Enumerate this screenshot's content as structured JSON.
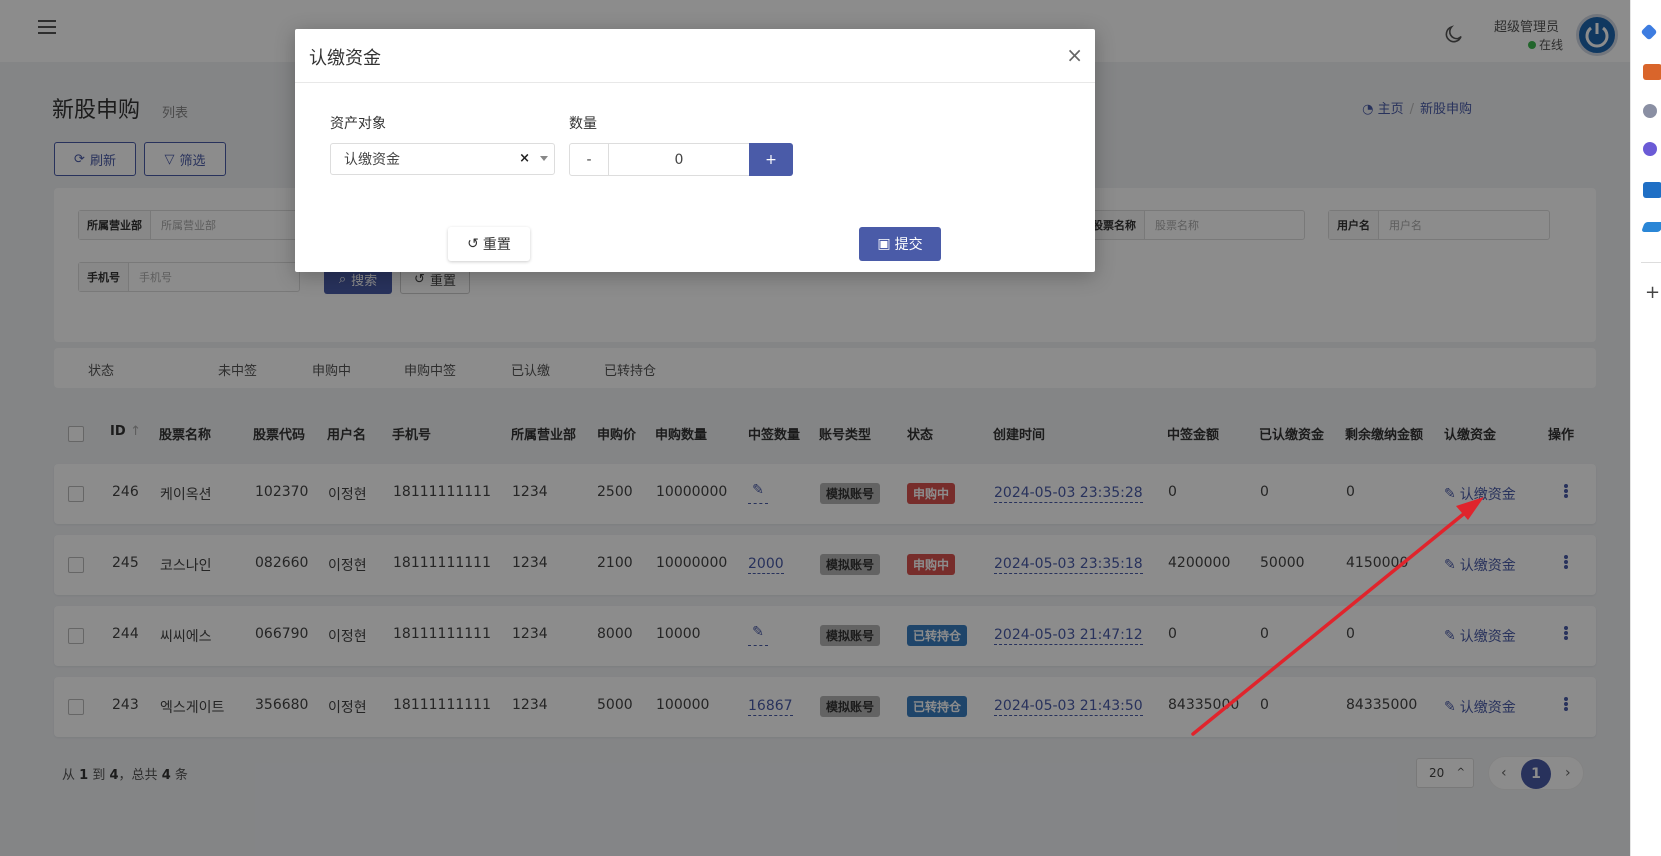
{
  "header": {
    "user_name": "超级管理员",
    "user_status": "在线"
  },
  "page": {
    "title": "新股申购",
    "subtitle": "列表",
    "breadcrumb": [
      "主页",
      "新股申购"
    ]
  },
  "toolbar": {
    "refresh_label": "刷新",
    "filter_label": "筛选"
  },
  "filters": {
    "fields": [
      {
        "label": "所属营业部",
        "placeholder": "所属营业部"
      },
      {
        "label": "股票名称",
        "placeholder": "股票名称"
      },
      {
        "label": "用户名",
        "placeholder": "用户名"
      },
      {
        "label": "手机号",
        "placeholder": "手机号"
      }
    ],
    "search_label": "搜索",
    "reset_label": "重置"
  },
  "status_tabs": [
    "状态",
    "未中签",
    "申购中",
    "申购中签",
    "已认缴",
    "已转持仓"
  ],
  "table": {
    "columns": [
      "ID",
      "股票名称",
      "股票代码",
      "用户名",
      "手机号",
      "所属营业部",
      "申购价",
      "申购数量",
      "中签数量",
      "账号类型",
      "状态",
      "创建时间",
      "中签金额",
      "已认缴资金",
      "剩余缴纳金额",
      "认缴资金",
      "操作"
    ],
    "sort_indicator": "↑",
    "rows": [
      {
        "id": "246",
        "name": "케이옥션",
        "code": "102370",
        "user": "이정현",
        "phone": "18111111111",
        "branch": "1234",
        "price": "2500",
        "qty": "10000000",
        "won": "",
        "acct": "模拟账号",
        "status": "申购中",
        "status_color": "#d9534f",
        "created": "2024-05-03 23:35:28",
        "won_amount": "0",
        "paid": "0",
        "remaining": "0",
        "action": "认缴资金"
      },
      {
        "id": "245",
        "name": "코스나인",
        "code": "082660",
        "user": "이정현",
        "phone": "18111111111",
        "branch": "1234",
        "price": "2100",
        "qty": "10000000",
        "won": "2000",
        "acct": "模拟账号",
        "status": "申购中",
        "status_color": "#d9534f",
        "created": "2024-05-03 23:35:18",
        "won_amount": "4200000",
        "paid": "50000",
        "remaining": "4150000",
        "action": "认缴资金"
      },
      {
        "id": "244",
        "name": "씨씨에스",
        "code": "066790",
        "user": "이정현",
        "phone": "18111111111",
        "branch": "1234",
        "price": "8000",
        "qty": "10000",
        "won": "",
        "acct": "模拟账号",
        "status": "已转持仓",
        "status_color": "#3a7fc2",
        "created": "2024-05-03 21:47:12",
        "won_amount": "0",
        "paid": "0",
        "remaining": "0",
        "action": "认缴资金"
      },
      {
        "id": "243",
        "name": "엑스게이트",
        "code": "356680",
        "user": "이정현",
        "phone": "18111111111",
        "branch": "1234",
        "price": "5000",
        "qty": "100000",
        "won": "16867",
        "acct": "模拟账号",
        "status": "已转持仓",
        "status_color": "#3a7fc2",
        "created": "2024-05-03 21:43:50",
        "won_amount": "84335000",
        "paid": "0",
        "remaining": "84335000",
        "action": "认缴资金"
      }
    ]
  },
  "pagination": {
    "info_prefix": "从",
    "from": "1",
    "to_word": "到",
    "to": "4",
    "total_word": "，总共",
    "total": "4",
    "unit": "条",
    "page_size": "20",
    "current_page": "1"
  },
  "modal": {
    "title": "认缴资金",
    "close": "×",
    "asset_label": "资产对象",
    "asset_value": "认缴资金",
    "clear": "×",
    "qty_label": "数量",
    "qty_value": "0",
    "minus": "-",
    "plus": "+",
    "reset_label": "重置",
    "submit_label": "提交"
  },
  "colors": {
    "primary": "#4a5ba8",
    "danger": "#d9534f",
    "info": "#3a7fc2",
    "annotation_arrow": "#e0242c"
  }
}
